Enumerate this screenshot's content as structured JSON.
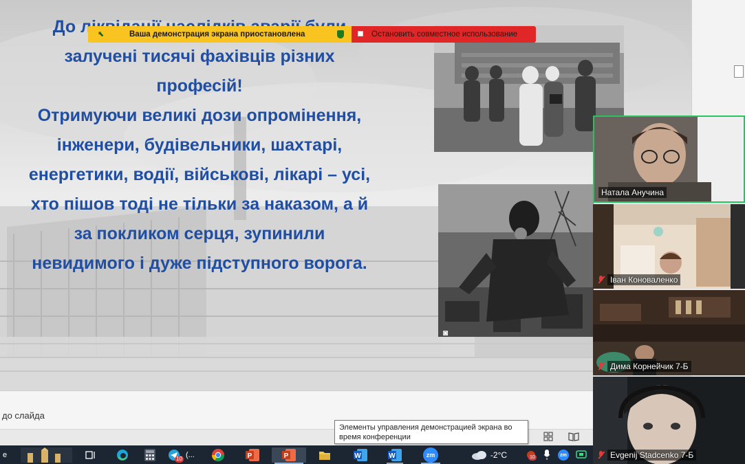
{
  "slide": {
    "text_lines": [
      "До ліквідації наслідків аварії були",
      "залучені тисячі фахівців різних",
      "професій!",
      "Отримуючи великі дози опромінення,",
      "інженери, будівельники, шахтарі,",
      "енергетики, водії, військові, лікарі – усі,",
      "хто пішов тоді не тільки за наказом, а й",
      "за покликом серця, зупинили",
      "невидимого і дуже підступного ворога."
    ],
    "text_color": "#1f4ea3"
  },
  "share_banner": {
    "paused_label": "Ваша демонстрация экрана приостановлена",
    "stop_label": "Остановить совместное использование",
    "paused_color": "#f9c41f",
    "stop_color": "#e02626"
  },
  "notes": {
    "placeholder_fragment": "до слайда"
  },
  "tooltip": {
    "text": "Элементы управления демонстрацией экрана во время конференции"
  },
  "participants": [
    {
      "name": "Натала Анучина",
      "muted": false,
      "active_speaker": true
    },
    {
      "name": "Іван Коноваленко",
      "muted": true,
      "active_speaker": false
    },
    {
      "name": "Дима Корнейчик 7-Б",
      "muted": true,
      "active_speaker": false
    },
    {
      "name": "Evgenij Stadcenko 7-Б",
      "muted": true,
      "active_speaker": false
    }
  ],
  "taskbar": {
    "start_fragment": "e",
    "telegram_badge": "10",
    "telegram_label": "(...",
    "zoom_label": "zm",
    "weather_temp": "-2°C",
    "tray_badge": "10",
    "tray_zoom_label": "zm"
  }
}
